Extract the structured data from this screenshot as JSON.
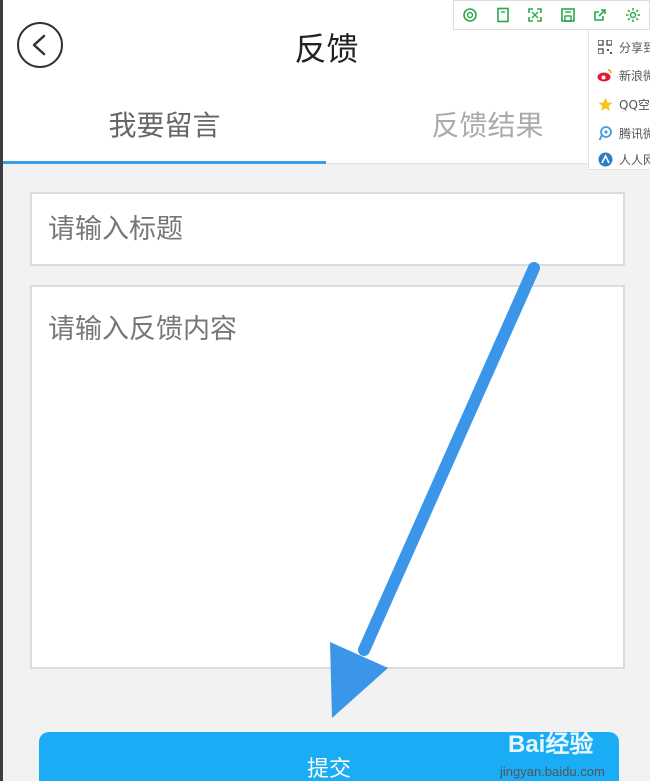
{
  "header": {
    "title": "反馈",
    "back_icon": "back-arrow-circle-icon"
  },
  "tabs": [
    {
      "label": "我要留言",
      "active": true
    },
    {
      "label": "反馈结果",
      "active": false
    }
  ],
  "form": {
    "title_placeholder": "请输入标题",
    "title_value": "",
    "content_placeholder": "请输入反馈内容",
    "content_value": "",
    "submit_label": "提交"
  },
  "toolbar": {
    "icons": [
      "search-icon",
      "bookmark-icon",
      "fullscreen-icon",
      "save-icon",
      "share-icon",
      "settings-icon"
    ],
    "accent_color": "#2aa84a"
  },
  "share_menu": {
    "items": [
      {
        "label": "分享到",
        "icon": "qrcode-icon"
      },
      {
        "label": "新浪微",
        "icon": "weibo-icon"
      },
      {
        "label": "QQ空",
        "icon": "qzone-star-icon"
      },
      {
        "label": "腾讯微",
        "icon": "tencent-weibo-icon"
      },
      {
        "label": "人人网",
        "icon": "renren-icon"
      }
    ]
  },
  "annotation": {
    "type": "arrow",
    "color": "#3b95e8",
    "points_to": "submit-button"
  },
  "watermark": {
    "logo": "Bai经验",
    "url": "jingyan.baidu.com"
  },
  "colors": {
    "tab_indicator": "#3aa0e6",
    "submit_bg": "#1aacf5",
    "content_bg": "#f2f2f2"
  }
}
